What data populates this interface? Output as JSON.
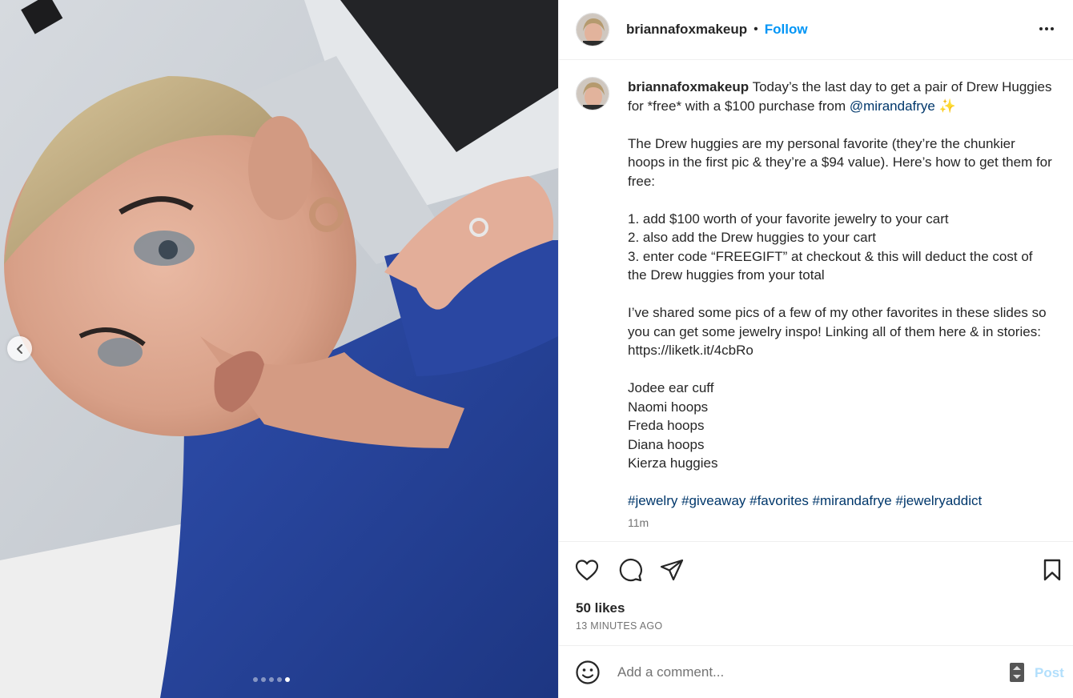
{
  "post": {
    "username": "briannafoxmakeup",
    "separator": "•",
    "follow_label": "Follow",
    "caption": {
      "username": "briannafoxmakeup",
      "intro": "Today’s the last day to get a pair of Drew Huggies for *free* with a $100 purchase from ",
      "mention": "@mirandafrye",
      "sparkle": "✨",
      "para2": "The Drew huggies are my personal favorite (they’re the chunkier hoops in the first pic & they’re a $94 value). Here’s how to get them for free:",
      "steps": [
        "1. add $100 worth of your favorite jewelry to your cart",
        "2. also add the Drew huggies to your cart",
        "3. enter code “FREEGIFT” at checkout & this will deduct the cost of the Drew huggies from your total"
      ],
      "para4": "I’ve shared some pics of a few of my other favorites in these slides so you can get some jewelry inspo! Linking all of them here & in stories: https://liketk.it/4cbRo",
      "items": [
        "Jodee ear cuff",
        "Naomi hoops",
        "Freda hoops",
        "Diana hoops",
        "Kierza huggies"
      ],
      "hashtags": "#jewelry #giveaway #favorites #mirandafrye #jewelryaddict",
      "time": "11m"
    },
    "likes": "50 likes",
    "posted_ago": "13 MINUTES AGO",
    "comment_placeholder": "Add a comment...",
    "post_label": "Post",
    "carousel": {
      "count": 5,
      "active": 5
    }
  },
  "icons": {
    "more": "more-horizontal-icon",
    "like": "heart-icon",
    "comment": "comment-icon",
    "share": "share-icon",
    "save": "bookmark-icon",
    "emoji": "emoji-icon",
    "prev": "chevron-left-icon"
  },
  "colors": {
    "accent": "#0095f6",
    "link": "#00376b",
    "post_disabled": "#b2dffc",
    "muted": "#737373"
  }
}
